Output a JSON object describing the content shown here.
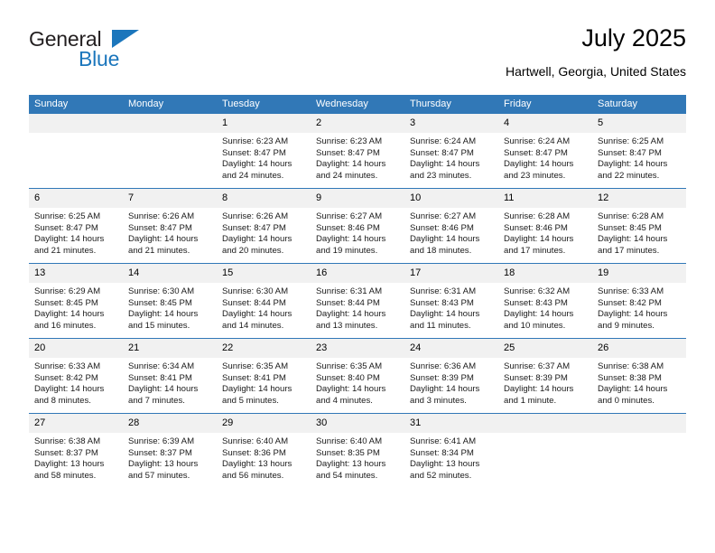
{
  "brand": {
    "name_primary": "General",
    "name_secondary": "Blue",
    "triangle_icon": "triangle-icon",
    "accent_color": "#1b76bc"
  },
  "header": {
    "title": "July 2025",
    "location": "Hartwell, Georgia, United States"
  },
  "calendar": {
    "header_bg": "#3178b7",
    "daynum_bg": "#f1f1f1",
    "weekday_headers": [
      "Sunday",
      "Monday",
      "Tuesday",
      "Wednesday",
      "Thursday",
      "Friday",
      "Saturday"
    ],
    "weeks": [
      [
        {
          "day": "",
          "blank": true,
          "sunrise": "",
          "sunset": "",
          "daylight": ""
        },
        {
          "day": "",
          "blank": true,
          "sunrise": "",
          "sunset": "",
          "daylight": ""
        },
        {
          "day": "1",
          "sunrise": "Sunrise: 6:23 AM",
          "sunset": "Sunset: 8:47 PM",
          "daylight": "Daylight: 14 hours and 24 minutes."
        },
        {
          "day": "2",
          "sunrise": "Sunrise: 6:23 AM",
          "sunset": "Sunset: 8:47 PM",
          "daylight": "Daylight: 14 hours and 24 minutes."
        },
        {
          "day": "3",
          "sunrise": "Sunrise: 6:24 AM",
          "sunset": "Sunset: 8:47 PM",
          "daylight": "Daylight: 14 hours and 23 minutes."
        },
        {
          "day": "4",
          "sunrise": "Sunrise: 6:24 AM",
          "sunset": "Sunset: 8:47 PM",
          "daylight": "Daylight: 14 hours and 23 minutes."
        },
        {
          "day": "5",
          "sunrise": "Sunrise: 6:25 AM",
          "sunset": "Sunset: 8:47 PM",
          "daylight": "Daylight: 14 hours and 22 minutes."
        }
      ],
      [
        {
          "day": "6",
          "sunrise": "Sunrise: 6:25 AM",
          "sunset": "Sunset: 8:47 PM",
          "daylight": "Daylight: 14 hours and 21 minutes."
        },
        {
          "day": "7",
          "sunrise": "Sunrise: 6:26 AM",
          "sunset": "Sunset: 8:47 PM",
          "daylight": "Daylight: 14 hours and 21 minutes."
        },
        {
          "day": "8",
          "sunrise": "Sunrise: 6:26 AM",
          "sunset": "Sunset: 8:47 PM",
          "daylight": "Daylight: 14 hours and 20 minutes."
        },
        {
          "day": "9",
          "sunrise": "Sunrise: 6:27 AM",
          "sunset": "Sunset: 8:46 PM",
          "daylight": "Daylight: 14 hours and 19 minutes."
        },
        {
          "day": "10",
          "sunrise": "Sunrise: 6:27 AM",
          "sunset": "Sunset: 8:46 PM",
          "daylight": "Daylight: 14 hours and 18 minutes."
        },
        {
          "day": "11",
          "sunrise": "Sunrise: 6:28 AM",
          "sunset": "Sunset: 8:46 PM",
          "daylight": "Daylight: 14 hours and 17 minutes."
        },
        {
          "day": "12",
          "sunrise": "Sunrise: 6:28 AM",
          "sunset": "Sunset: 8:45 PM",
          "daylight": "Daylight: 14 hours and 17 minutes."
        }
      ],
      [
        {
          "day": "13",
          "sunrise": "Sunrise: 6:29 AM",
          "sunset": "Sunset: 8:45 PM",
          "daylight": "Daylight: 14 hours and 16 minutes."
        },
        {
          "day": "14",
          "sunrise": "Sunrise: 6:30 AM",
          "sunset": "Sunset: 8:45 PM",
          "daylight": "Daylight: 14 hours and 15 minutes."
        },
        {
          "day": "15",
          "sunrise": "Sunrise: 6:30 AM",
          "sunset": "Sunset: 8:44 PM",
          "daylight": "Daylight: 14 hours and 14 minutes."
        },
        {
          "day": "16",
          "sunrise": "Sunrise: 6:31 AM",
          "sunset": "Sunset: 8:44 PM",
          "daylight": "Daylight: 14 hours and 13 minutes."
        },
        {
          "day": "17",
          "sunrise": "Sunrise: 6:31 AM",
          "sunset": "Sunset: 8:43 PM",
          "daylight": "Daylight: 14 hours and 11 minutes."
        },
        {
          "day": "18",
          "sunrise": "Sunrise: 6:32 AM",
          "sunset": "Sunset: 8:43 PM",
          "daylight": "Daylight: 14 hours and 10 minutes."
        },
        {
          "day": "19",
          "sunrise": "Sunrise: 6:33 AM",
          "sunset": "Sunset: 8:42 PM",
          "daylight": "Daylight: 14 hours and 9 minutes."
        }
      ],
      [
        {
          "day": "20",
          "sunrise": "Sunrise: 6:33 AM",
          "sunset": "Sunset: 8:42 PM",
          "daylight": "Daylight: 14 hours and 8 minutes."
        },
        {
          "day": "21",
          "sunrise": "Sunrise: 6:34 AM",
          "sunset": "Sunset: 8:41 PM",
          "daylight": "Daylight: 14 hours and 7 minutes."
        },
        {
          "day": "22",
          "sunrise": "Sunrise: 6:35 AM",
          "sunset": "Sunset: 8:41 PM",
          "daylight": "Daylight: 14 hours and 5 minutes."
        },
        {
          "day": "23",
          "sunrise": "Sunrise: 6:35 AM",
          "sunset": "Sunset: 8:40 PM",
          "daylight": "Daylight: 14 hours and 4 minutes."
        },
        {
          "day": "24",
          "sunrise": "Sunrise: 6:36 AM",
          "sunset": "Sunset: 8:39 PM",
          "daylight": "Daylight: 14 hours and 3 minutes."
        },
        {
          "day": "25",
          "sunrise": "Sunrise: 6:37 AM",
          "sunset": "Sunset: 8:39 PM",
          "daylight": "Daylight: 14 hours and 1 minute."
        },
        {
          "day": "26",
          "sunrise": "Sunrise: 6:38 AM",
          "sunset": "Sunset: 8:38 PM",
          "daylight": "Daylight: 14 hours and 0 minutes."
        }
      ],
      [
        {
          "day": "27",
          "sunrise": "Sunrise: 6:38 AM",
          "sunset": "Sunset: 8:37 PM",
          "daylight": "Daylight: 13 hours and 58 minutes."
        },
        {
          "day": "28",
          "sunrise": "Sunrise: 6:39 AM",
          "sunset": "Sunset: 8:37 PM",
          "daylight": "Daylight: 13 hours and 57 minutes."
        },
        {
          "day": "29",
          "sunrise": "Sunrise: 6:40 AM",
          "sunset": "Sunset: 8:36 PM",
          "daylight": "Daylight: 13 hours and 56 minutes."
        },
        {
          "day": "30",
          "sunrise": "Sunrise: 6:40 AM",
          "sunset": "Sunset: 8:35 PM",
          "daylight": "Daylight: 13 hours and 54 minutes."
        },
        {
          "day": "31",
          "sunrise": "Sunrise: 6:41 AM",
          "sunset": "Sunset: 8:34 PM",
          "daylight": "Daylight: 13 hours and 52 minutes."
        },
        {
          "day": "",
          "blank": true,
          "sunrise": "",
          "sunset": "",
          "daylight": ""
        },
        {
          "day": "",
          "blank": true,
          "sunrise": "",
          "sunset": "",
          "daylight": ""
        }
      ]
    ]
  }
}
